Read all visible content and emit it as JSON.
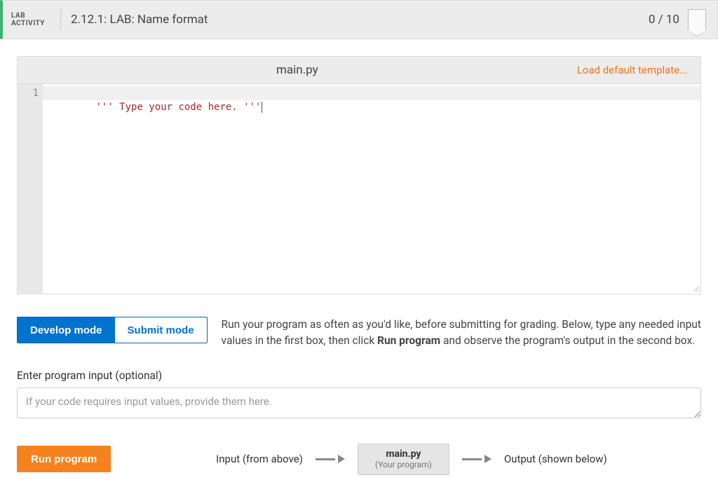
{
  "header": {
    "activity_label_line1": "LAB",
    "activity_label_line2": "ACTIVITY",
    "title": "2.12.1: LAB: Name format",
    "score": "0 / 10"
  },
  "editor": {
    "filename": "main.py",
    "load_template_label": "Load default template...",
    "line_number": "1",
    "code_line_1": "''' Type your code here. '''"
  },
  "modes": {
    "develop": "Develop mode",
    "submit": "Submit mode"
  },
  "instructions": {
    "pre": "Run your program as often as you'd like, before submitting for grading. Below, type any needed input values in the first box, then click ",
    "bold": "Run program",
    "post": " and observe the program's output in the second box."
  },
  "input": {
    "label": "Enter program input (optional)",
    "placeholder": "If your code requires input values, provide them here."
  },
  "run": {
    "button": "Run program",
    "input_label": "Input (from above)",
    "program_name": "main.py",
    "program_sub": "(Your program)",
    "output_label": "Output (shown below)"
  }
}
